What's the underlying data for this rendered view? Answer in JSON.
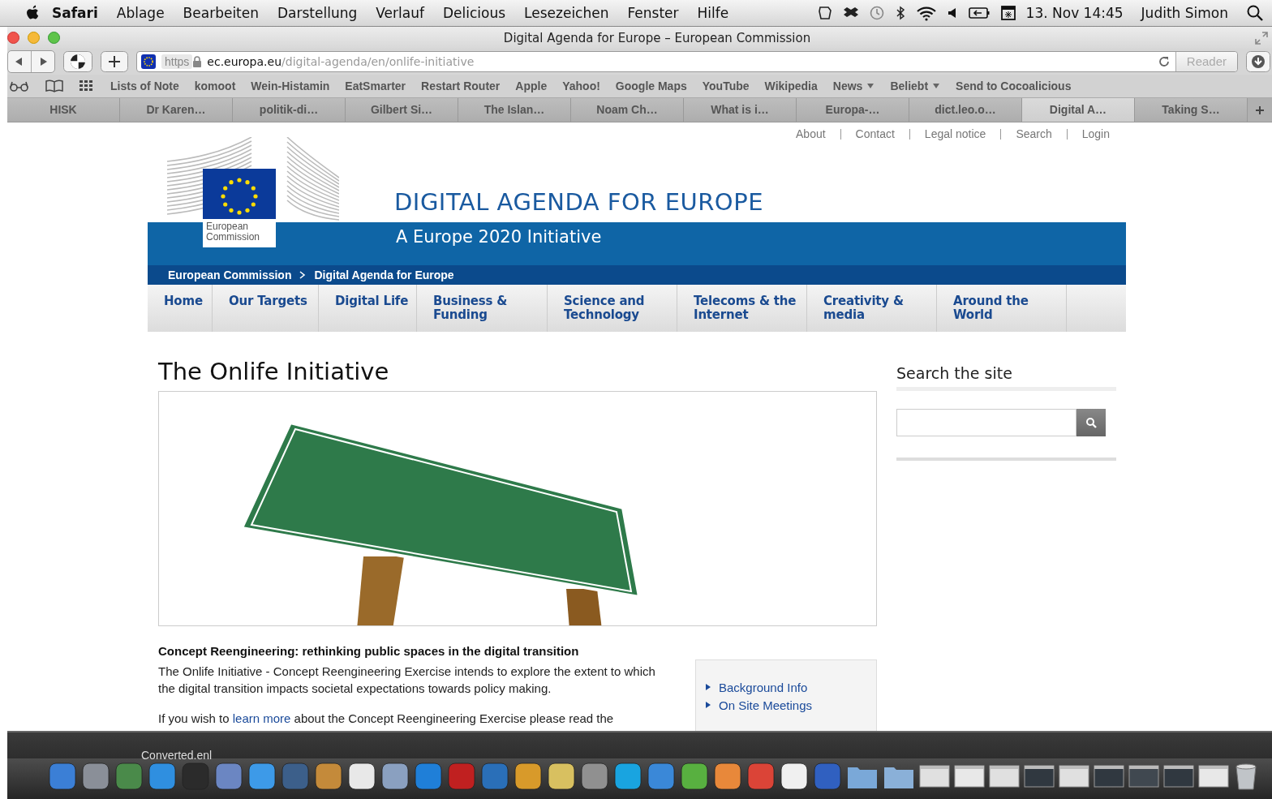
{
  "menu_bar": {
    "app": "Safari",
    "menus": [
      "Ablage",
      "Bearbeiten",
      "Darstellung",
      "Verlauf",
      "Delicious",
      "Lesezeichen",
      "Fenster",
      "Hilfe"
    ],
    "date": "13. Nov",
    "time": "14:45",
    "user": "Judith Simon"
  },
  "window": {
    "title": "Digital Agenda for Europe – European Commission"
  },
  "toolbar": {
    "url_scheme": "https",
    "url_host": "ec.europa.eu",
    "url_path": "/digital-agenda/en/onlife-initiative",
    "reader": "Reader"
  },
  "bookmarks": [
    {
      "label": "Lists of Note",
      "menu": false
    },
    {
      "label": "komoot",
      "menu": false
    },
    {
      "label": "Wein-Histamin",
      "menu": false
    },
    {
      "label": "EatSmarter",
      "menu": false
    },
    {
      "label": "Restart Router",
      "menu": false
    },
    {
      "label": "Apple",
      "menu": false
    },
    {
      "label": "Yahoo!",
      "menu": false
    },
    {
      "label": "Google Maps",
      "menu": false
    },
    {
      "label": "YouTube",
      "menu": false
    },
    {
      "label": "Wikipedia",
      "menu": false
    },
    {
      "label": "News",
      "menu": true
    },
    {
      "label": "Beliebt",
      "menu": true
    },
    {
      "label": "Send to Cocoalicious",
      "menu": false
    }
  ],
  "tabs": [
    {
      "label": "HISK",
      "selected": false
    },
    {
      "label": "Dr Karen…",
      "selected": false
    },
    {
      "label": "politik-di…",
      "selected": false
    },
    {
      "label": "Gilbert Si…",
      "selected": false
    },
    {
      "label": "The Islan…",
      "selected": false
    },
    {
      "label": "Noam Ch…",
      "selected": false
    },
    {
      "label": "What is i…",
      "selected": false
    },
    {
      "label": "Europa-…",
      "selected": false
    },
    {
      "label": "dict.leo.o…",
      "selected": false
    },
    {
      "label": "Digital A…",
      "selected": true
    },
    {
      "label": "Taking S…",
      "selected": false
    }
  ],
  "page": {
    "top_links": [
      "About",
      "Contact",
      "Legal notice",
      "Search",
      "Login"
    ],
    "logo_text": "European Commission",
    "site_title": "DIGITAL AGENDA FOR EUROPE",
    "site_subtitle": "A Europe 2020 Initiative",
    "breadcrumb": [
      "European Commission",
      "Digital Agenda for Europe"
    ],
    "nav": [
      "Home",
      "Our Targets",
      "Digital Life",
      "Business & Funding",
      "Science and Technology",
      "Telecoms & the Internet",
      "Creativity & media",
      "Around the World"
    ],
    "heading": "The Onlife Initiative",
    "subheading": "Concept Reengineering: rethinking public spaces in the digital transition",
    "intro": "The Onlife Initiative - Concept Reengineering Exercise intends to explore the extent to which the digital transition impacts societal expectations towards policy making.",
    "more": {
      "before": "If you wish to",
      "link": "learn more",
      "after": "about the Concept Reengineering Exercise please read the"
    },
    "related_links": [
      "Background Info",
      "On Site Meetings"
    ],
    "sidebar": {
      "title": "Search the site"
    }
  },
  "dock": {
    "desktop_label": "Converted.enl",
    "items": [
      {
        "kind": "app",
        "color": "#3b7fd6"
      },
      {
        "kind": "app",
        "color": "#8a8f98"
      },
      {
        "kind": "app",
        "color": "#4a8a4a"
      },
      {
        "kind": "app",
        "color": "#2f8fe0"
      },
      {
        "kind": "app",
        "color": "#2b2b2b"
      },
      {
        "kind": "app",
        "color": "#6b86c2"
      },
      {
        "kind": "app",
        "color": "#3d9ae8"
      },
      {
        "kind": "app",
        "color": "#3c5f8a"
      },
      {
        "kind": "app",
        "color": "#c48a3a"
      },
      {
        "kind": "app",
        "color": "#e8e8e8"
      },
      {
        "kind": "app",
        "color": "#8aa0c0"
      },
      {
        "kind": "app",
        "color": "#1f7fd8"
      },
      {
        "kind": "app",
        "color": "#c02020"
      },
      {
        "kind": "app",
        "color": "#2a6fb8"
      },
      {
        "kind": "app",
        "color": "#d89a2a"
      },
      {
        "kind": "app",
        "color": "#d8c060"
      },
      {
        "kind": "app",
        "color": "#909090"
      },
      {
        "kind": "app",
        "color": "#19a4e0"
      },
      {
        "kind": "app",
        "color": "#3a88d8"
      },
      {
        "kind": "app",
        "color": "#58b040"
      },
      {
        "kind": "app",
        "color": "#e8883a"
      },
      {
        "kind": "app",
        "color": "#db4437"
      },
      {
        "kind": "app",
        "color": "#f0f0f0"
      },
      {
        "kind": "app",
        "color": "#3060c0"
      },
      {
        "kind": "folder",
        "color": "#7aa8d8"
      },
      {
        "kind": "folder",
        "color": "#8ab0d8"
      },
      {
        "kind": "window",
        "color": "#e0e0e0"
      },
      {
        "kind": "window",
        "color": "#e8e8e8"
      },
      {
        "kind": "window",
        "color": "#e0e0e0"
      },
      {
        "kind": "window",
        "color": "#303840"
      },
      {
        "kind": "window",
        "color": "#e0e0e0"
      },
      {
        "kind": "window",
        "color": "#303840"
      },
      {
        "kind": "window",
        "color": "#404850"
      },
      {
        "kind": "window",
        "color": "#303840"
      },
      {
        "kind": "window",
        "color": "#e8e8e8"
      },
      {
        "kind": "trash",
        "color": "#c0c4c8"
      }
    ]
  }
}
